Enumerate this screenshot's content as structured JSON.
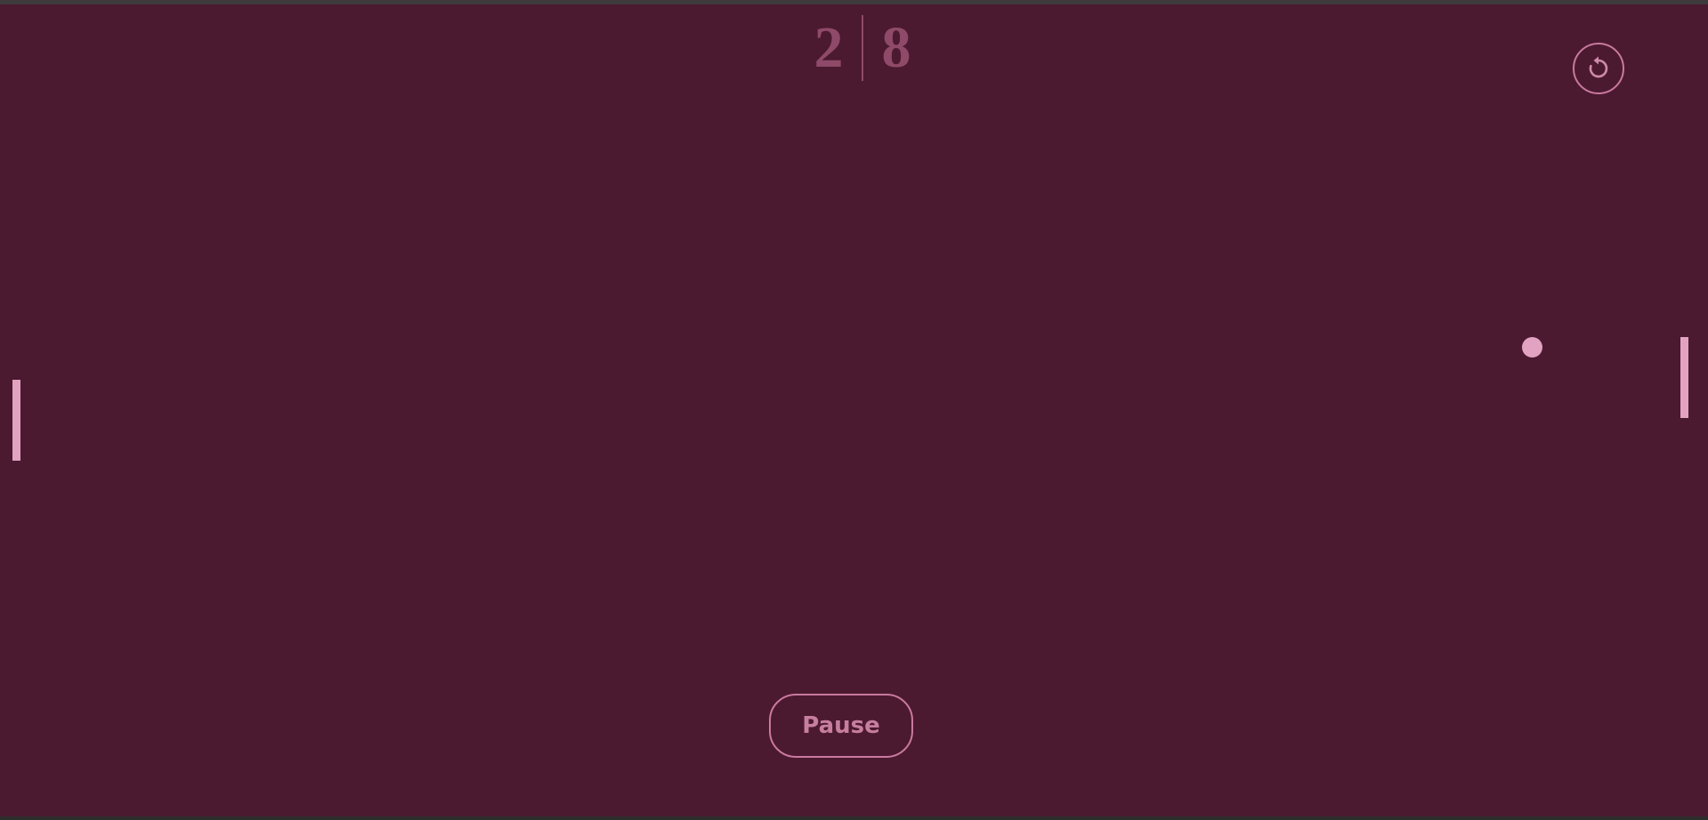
{
  "scoreboard": {
    "left_score": "2",
    "right_score": "8"
  },
  "controls": {
    "restart_icon": "restart-icon",
    "pause_label": "Pause"
  },
  "colors": {
    "background": "#4b1a30",
    "paddle": "#e2a3c3",
    "ball": "#e2a3c3",
    "score_text": "#8f4a69",
    "button_outline": "#c9799f",
    "button_text": "#c77e9f"
  }
}
